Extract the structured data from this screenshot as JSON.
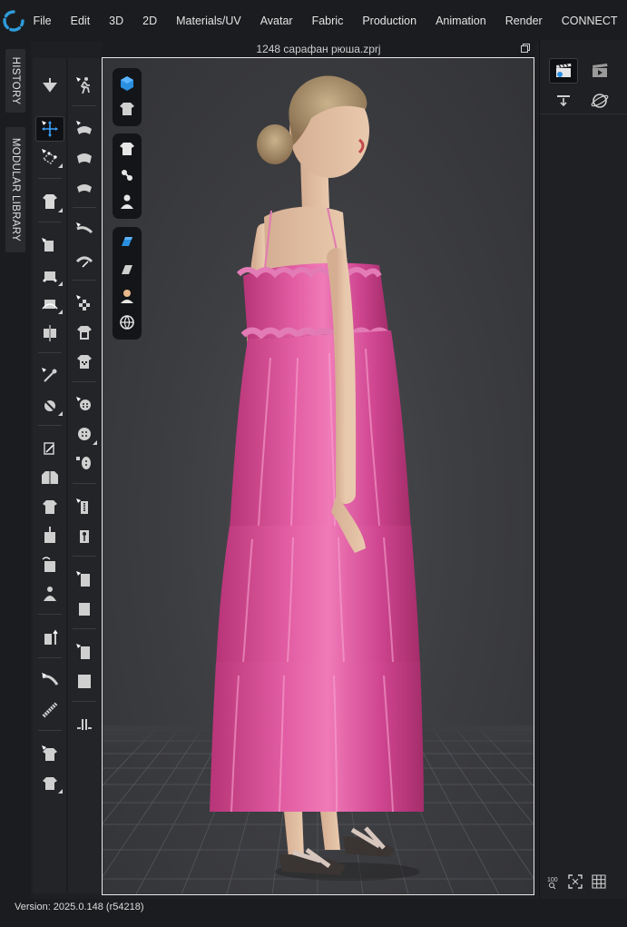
{
  "app": {
    "logo_icon": "clo-logo-icon",
    "accent": "#2e9bdb"
  },
  "menu": [
    "File",
    "Edit",
    "3D",
    "2D",
    "Materials/UV",
    "Avatar",
    "Fabric",
    "Production",
    "Animation",
    "Render",
    "CONNECT"
  ],
  "side_tabs": [
    "HISTORY",
    "MODULAR LIBRARY"
  ],
  "file": {
    "title": "1248 сарафан рюша.zprj"
  },
  "tools_col1": [
    "select-move-icon",
    "transform-pattern-icon",
    "garment-icon",
    "segment-icon",
    "pattern-icon",
    "curve-icon",
    "symmetry-icon",
    "pin-icon",
    "fold-icon",
    "cut-icon",
    "jacket-icon",
    "tshirt-icon",
    "fabric-icon",
    "grading-icon",
    "avatar-icon",
    "shuffle-icon",
    "tape-icon",
    "zip-icon",
    "shirt-icon",
    "shirt-small-icon"
  ],
  "tools_col2": [
    "walk-icon",
    "simulate-icon",
    "simulate2-icon",
    "simulate3-icon",
    "sew-icon",
    "sew2-icon",
    "check-icon",
    "check2-icon",
    "checker-icon",
    "button-icon",
    "button2-icon",
    "zipper-icon",
    "zipper2-icon",
    "puckering-icon",
    "puckering2-icon",
    "fabric-piece-icon",
    "fabric-piece2-icon",
    "fold-arrange-icon"
  ],
  "viewport_tools": [
    "3d-cube-icon",
    "garment-display-icon",
    "tshirt-icon",
    "avatar-pose-icon",
    "avatar-icon",
    "fabric-icon",
    "surface-icon",
    "avatar-skin-icon",
    "globe-icon"
  ],
  "right_panel": [
    "clapperboard-icon",
    "video-icon",
    "download-icon",
    "orbit-icon"
  ],
  "right_bottom": [
    "zoom-100-icon",
    "fit-icon",
    "grid-icon"
  ],
  "status": {
    "version": "Version: 2025.0.148 (r54218)"
  },
  "colors": {
    "dress": "#d94a93",
    "viewport_bg": "#3e3f43"
  }
}
